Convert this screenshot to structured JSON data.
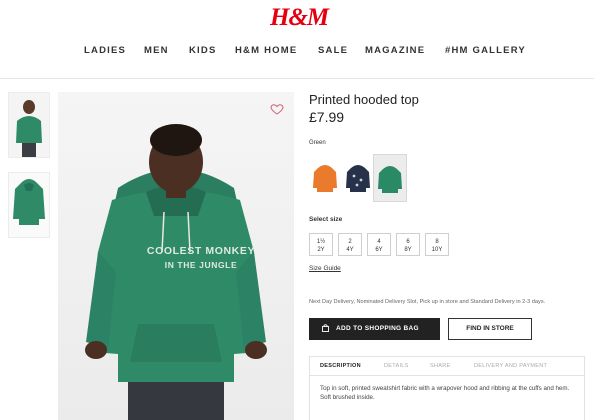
{
  "brand": {
    "logo_text": "H&M",
    "color": "#e50010"
  },
  "nav": [
    "LADIES",
    "MEN",
    "KIDS",
    "H&M HOME",
    "SALE",
    "MAGAZINE",
    "#HM GALLERY"
  ],
  "hero": {
    "print_line1": "COOLEST MONKEY",
    "print_line2": "IN THE JUNGLE"
  },
  "product": {
    "title": "Printed hooded top",
    "price": "£7.99",
    "color_label": "Green",
    "swatches": [
      {
        "name": "orange",
        "color": "#ea7a2c"
      },
      {
        "name": "navy",
        "color": "#27324a"
      },
      {
        "name": "green",
        "color": "#2a8a66",
        "selected": true
      }
    ],
    "size_label": "Select size",
    "sizes": [
      [
        "1½",
        "2Y"
      ],
      [
        "2",
        "4Y"
      ],
      [
        "4",
        "6Y"
      ],
      [
        "6",
        "8Y"
      ],
      [
        "8",
        "10Y"
      ]
    ],
    "size_guide": "Size Guide",
    "delivery_text": "Next Day Delivery, Nominated Delivery Slot, Pick up in store and Standard Delivery in 2-3 days.",
    "add_to_bag": "ADD TO SHOPPING BAG",
    "find_in_store": "FIND IN STORE",
    "tabs": [
      "DESCRIPTION",
      "DETAILS",
      "SHARE",
      "DELIVERY AND PAYMENT"
    ],
    "description": "Top in soft, printed sweatshirt fabric with a wrapover hood and ribbing at the cuffs and hem. Soft brushed inside."
  },
  "colors": {
    "hoodie_green": "#2f8a68",
    "accent_dark": "#222222"
  },
  "icons": [
    "heart-icon",
    "shopping-bag-icon"
  ]
}
